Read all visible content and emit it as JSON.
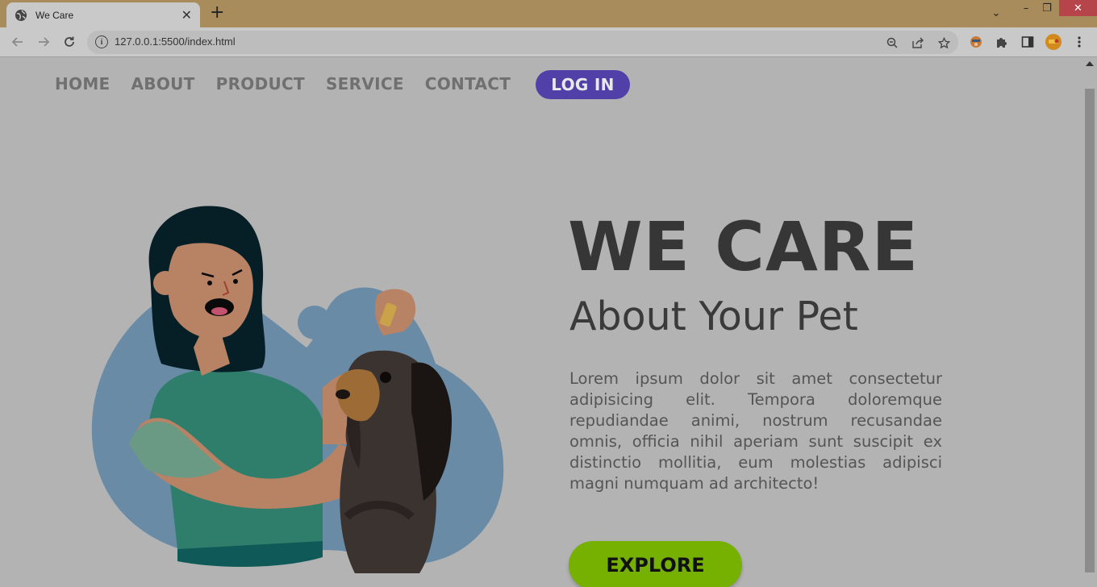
{
  "browser": {
    "tab_title": "We Care",
    "new_tab_symbol": "+",
    "tab_close_symbol": "✕",
    "url": "127.0.0.1:5500/index.html",
    "window_controls": {
      "chevron": "⌄",
      "minimize": "–",
      "restore": "❐",
      "close": "✕"
    },
    "toolbar_icons": [
      "zoom-icon",
      "share-icon",
      "star-icon",
      "extension-avatar-icon",
      "puzzle-icon",
      "side-panel-icon",
      "profile-avatar",
      "menu-icon"
    ]
  },
  "nav": {
    "items": [
      {
        "label": "HOME"
      },
      {
        "label": "ABOUT"
      },
      {
        "label": "PRODUCT"
      },
      {
        "label": "SERVICE"
      },
      {
        "label": "CONTACT"
      }
    ],
    "login_label": "LOG IN"
  },
  "hero": {
    "title": "WE CARE",
    "subtitle": "About Your Pet",
    "body": "Lorem ipsum dolor sit amet consectetur adipisicing elit. Tempora doloremque repudiandae animi, nostrum recusandae omnis, officia nihil aperiam sunt suscipit ex distinctio mollitia, eum molestias adipisci magni numquam ad architecto!",
    "cta_label": "EXPLORE"
  },
  "colors": {
    "page_bg": "#b3b3b3",
    "login_bg": "#5040a8",
    "cta_bg": "#76b000",
    "title": "#363636",
    "nav_text": "#707070",
    "titlebar": "#a88c5c"
  }
}
